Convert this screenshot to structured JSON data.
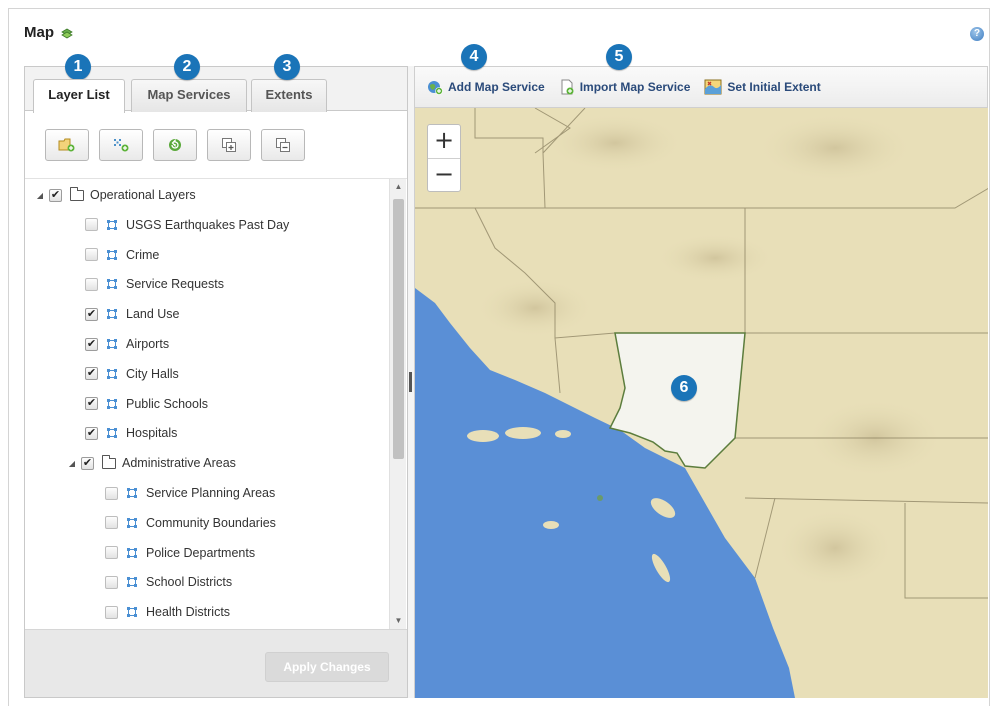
{
  "page": {
    "title": "Map",
    "title_icon": "map-layers-icon",
    "help_icon": "help-icon"
  },
  "left_panel": {
    "tabs": [
      {
        "label": "Layer List",
        "active": true
      },
      {
        "label": "Map Services",
        "active": false
      },
      {
        "label": "Extents",
        "active": false
      }
    ],
    "toolbar": [
      {
        "icon": "add-folder-icon"
      },
      {
        "icon": "add-layer-icon"
      },
      {
        "icon": "refresh-icon"
      },
      {
        "icon": "expand-all-icon"
      },
      {
        "icon": "collapse-all-icon"
      }
    ],
    "tree": [
      {
        "label": "Operational Layers",
        "type": "folder",
        "checked": true,
        "expanded": true,
        "level": 0
      },
      {
        "label": "USGS Earthquakes Past Day",
        "type": "layer",
        "checked": false,
        "level": 1
      },
      {
        "label": "Crime",
        "type": "layer",
        "checked": false,
        "level": 1
      },
      {
        "label": "Service Requests",
        "type": "layer",
        "checked": false,
        "level": 1
      },
      {
        "label": "Land Use",
        "type": "layer",
        "checked": true,
        "level": 1
      },
      {
        "label": "Airports",
        "type": "layer",
        "checked": true,
        "level": 1
      },
      {
        "label": "City Halls",
        "type": "layer",
        "checked": true,
        "level": 1
      },
      {
        "label": "Public Schools",
        "type": "layer",
        "checked": true,
        "level": 1
      },
      {
        "label": "Hospitals",
        "type": "layer",
        "checked": true,
        "level": 1
      },
      {
        "label": "Administrative Areas",
        "type": "folder",
        "checked": true,
        "expanded": true,
        "level": 1
      },
      {
        "label": "Service Planning Areas",
        "type": "layer",
        "checked": false,
        "level": 2
      },
      {
        "label": "Community Boundaries",
        "type": "layer",
        "checked": false,
        "level": 2
      },
      {
        "label": "Police Departments",
        "type": "layer",
        "checked": false,
        "level": 2
      },
      {
        "label": "School Districts",
        "type": "layer",
        "checked": false,
        "level": 2
      },
      {
        "label": "Health Districts",
        "type": "layer",
        "checked": false,
        "level": 2
      }
    ],
    "apply_button": "Apply Changes"
  },
  "map_toolbar": {
    "add_map_service": "Add Map Service",
    "import_map_service": "Import Map Service",
    "set_initial_extent": "Set Initial Extent"
  },
  "map": {
    "zoom_in": "+",
    "zoom_out": "−"
  },
  "callouts": [
    "1",
    "2",
    "3",
    "4",
    "5",
    "6"
  ],
  "colors": {
    "callout": "#1a74b8",
    "ocean": "#5a8fd6",
    "land": "#e8dfb8",
    "highlight_county": "#f4f4ee",
    "toolbar_text": "#2a4a7a"
  }
}
